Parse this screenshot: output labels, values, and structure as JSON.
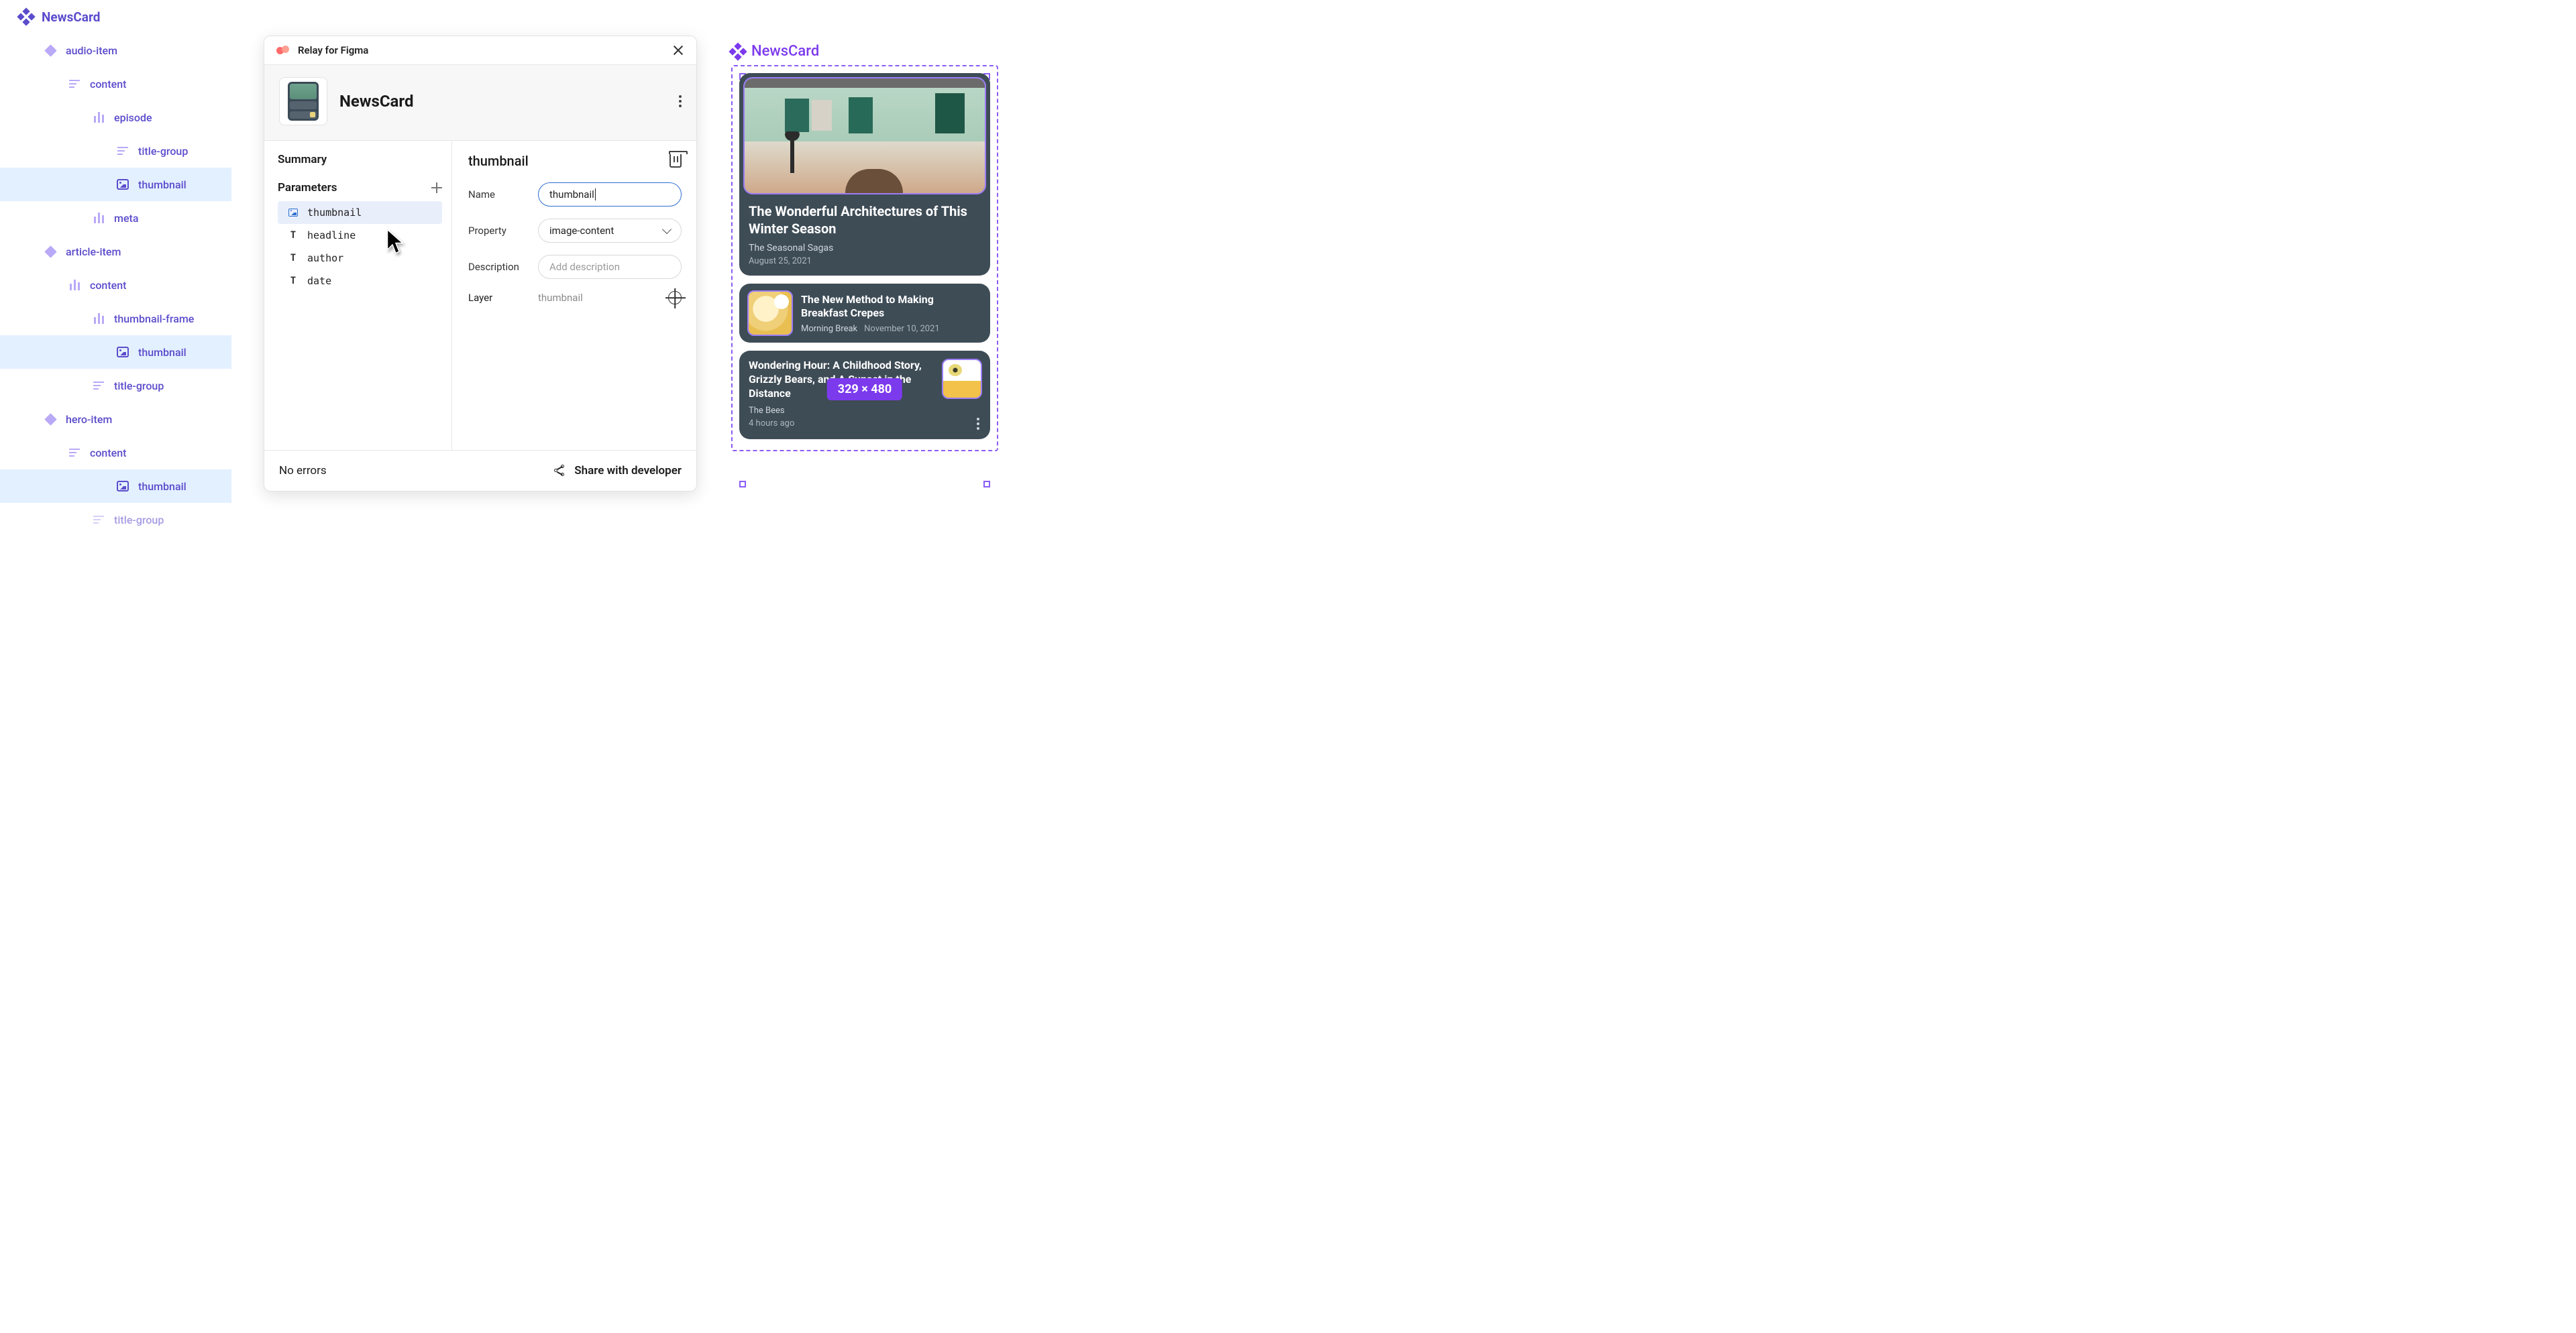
{
  "sidebar": {
    "root": "NewsCard",
    "rows": [
      {
        "label": "audio-item"
      },
      {
        "label": "content"
      },
      {
        "label": "episode"
      },
      {
        "label": "title-group"
      },
      {
        "label": "thumbnail"
      },
      {
        "label": "meta"
      },
      {
        "label": "article-item"
      },
      {
        "label": "content"
      },
      {
        "label": "thumbnail-frame"
      },
      {
        "label": "thumbnail"
      },
      {
        "label": "title-group"
      },
      {
        "label": "hero-item"
      },
      {
        "label": "content"
      },
      {
        "label": "thumbnail"
      },
      {
        "label": "title-group"
      }
    ]
  },
  "panel": {
    "app_title": "Relay for Figma",
    "component_name": "NewsCard",
    "summary_label": "Summary",
    "parameters_label": "Parameters",
    "params": [
      {
        "name": "thumbnail"
      },
      {
        "name": "headline"
      },
      {
        "name": "author"
      },
      {
        "name": "date"
      }
    ],
    "right": {
      "title": "thumbnail",
      "name_label": "Name",
      "name_value": "thumbnail",
      "property_label": "Property",
      "property_value": "image-content",
      "description_label": "Description",
      "description_placeholder": "Add description",
      "layer_label": "Layer",
      "layer_value": "thumbnail"
    },
    "footer": {
      "errors": "No errors",
      "share": "Share with developer"
    }
  },
  "canvas": {
    "title": "NewsCard",
    "size_badge": "329 × 480",
    "hero": {
      "headline": "The Wonderful Architectures of This Winter Season",
      "source": "The Seasonal Sagas",
      "date": "August 25, 2021"
    },
    "article": {
      "headline": "The New Method to Making Breakfast Crepes",
      "source": "Morning Break",
      "date": "November 10, 2021"
    },
    "audio": {
      "headline": "Wondering Hour: A Childhood Story, Grizzly Bears, and A Sunset in the Distance",
      "source": "The Bees",
      "time": "4 hours ago"
    }
  }
}
